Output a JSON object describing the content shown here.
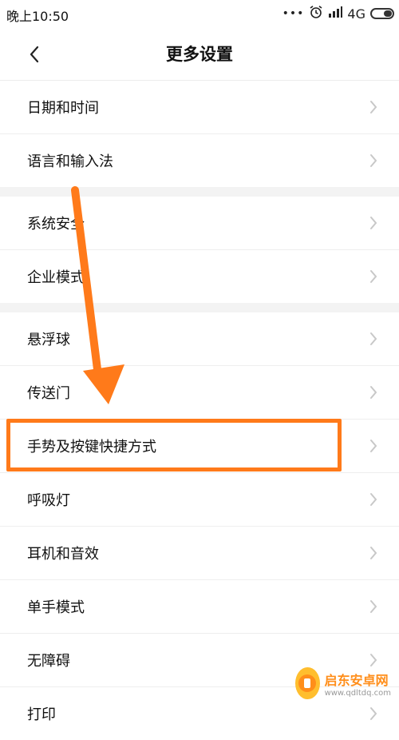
{
  "statusbar": {
    "time": "晚上10:50",
    "network": "4G",
    "dots": "•••"
  },
  "header": {
    "title": "更多设置"
  },
  "groups": [
    {
      "items": [
        {
          "label": "日期和时间"
        },
        {
          "label": "语言和输入法"
        }
      ]
    },
    {
      "items": [
        {
          "label": "系统安全"
        },
        {
          "label": "企业模式"
        }
      ]
    },
    {
      "items": [
        {
          "label": "悬浮球"
        },
        {
          "label": "传送门"
        },
        {
          "label": "手势及按键快捷方式"
        },
        {
          "label": "呼吸灯"
        },
        {
          "label": "耳机和音效"
        },
        {
          "label": "单手模式"
        },
        {
          "label": "无障碍"
        },
        {
          "label": "打印"
        }
      ]
    }
  ],
  "watermark": {
    "title": "启东安卓网",
    "url": "www.qdltdq.com"
  },
  "colors": {
    "accent": "#ff7a1a",
    "divider": "#eeeeee",
    "section_gap": "#f3f3f3"
  }
}
